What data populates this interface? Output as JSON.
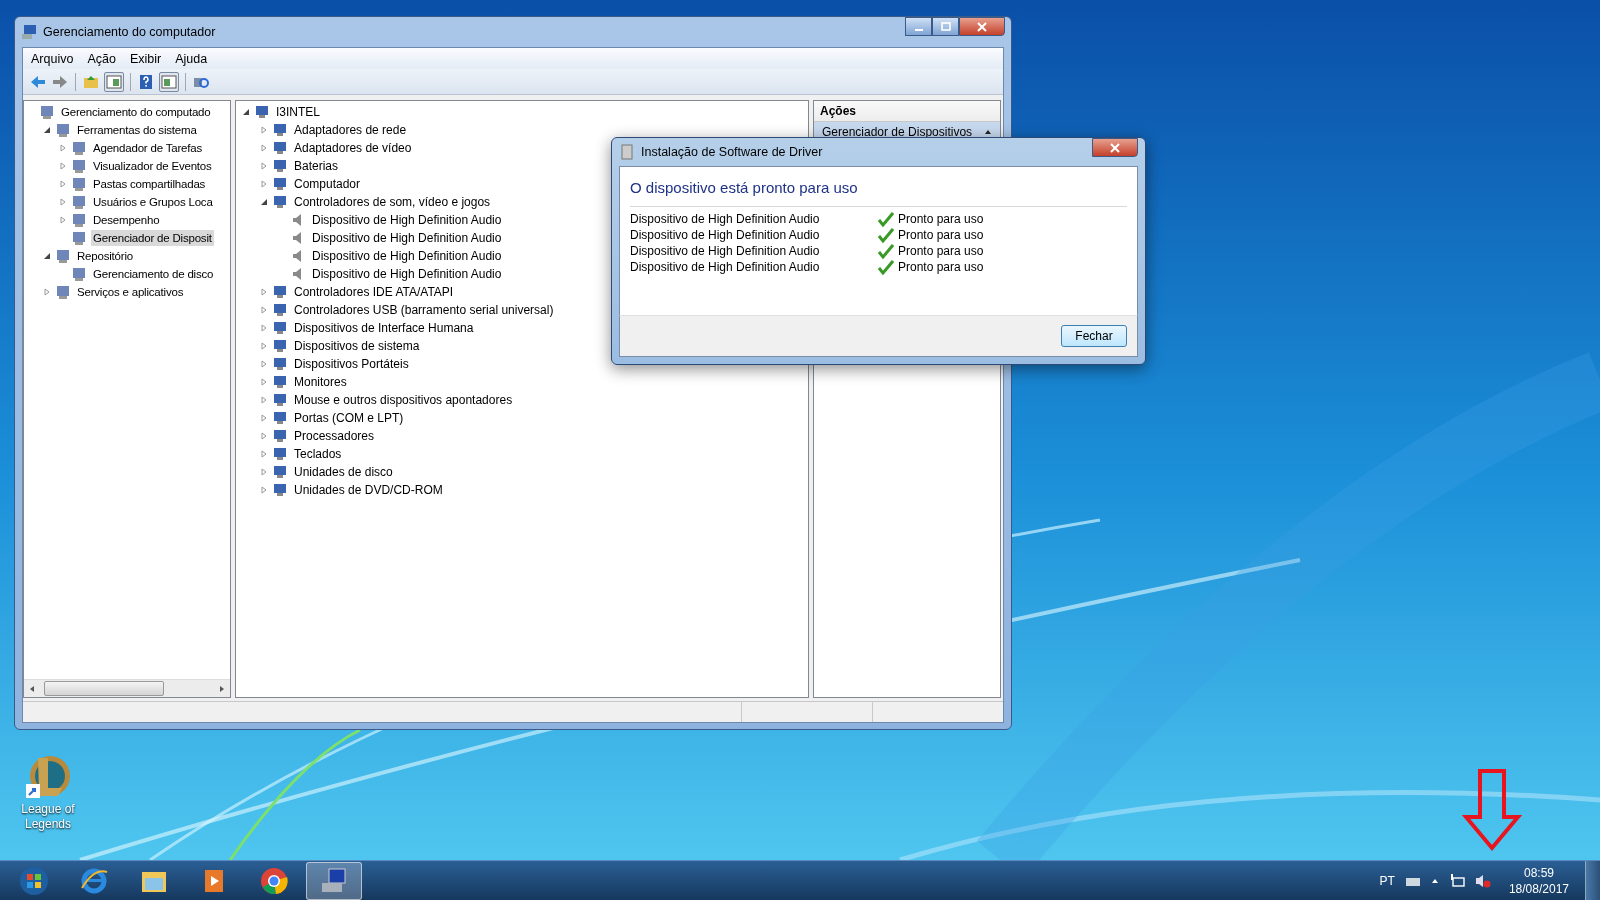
{
  "window": {
    "title": "Gerenciamento do computador",
    "menu": [
      "Arquivo",
      "Ação",
      "Exibir",
      "Ajuda"
    ]
  },
  "nav_tree": [
    {
      "label": "Gerenciamento do computado",
      "kind": "leaf",
      "selected": false,
      "children": [
        {
          "label": "Ferramentas do sistema",
          "kind": "branch",
          "expanded": true,
          "selected": false,
          "children": [
            {
              "label": "Agendador de Tarefas",
              "kind": "branch",
              "expanded": false,
              "selected": false
            },
            {
              "label": "Visualizador de Eventos",
              "kind": "branch",
              "expanded": false,
              "selected": false
            },
            {
              "label": "Pastas compartilhadas",
              "kind": "branch",
              "expanded": false,
              "selected": false
            },
            {
              "label": "Usuários e Grupos Loca",
              "kind": "branch",
              "expanded": false,
              "selected": false
            },
            {
              "label": "Desempenho",
              "kind": "branch",
              "expanded": false,
              "selected": false
            },
            {
              "label": "Gerenciador de Disposit",
              "kind": "leaf",
              "selected": true
            }
          ]
        },
        {
          "label": "Repositório",
          "kind": "branch",
          "expanded": true,
          "selected": false,
          "children": [
            {
              "label": "Gerenciamento de disco",
              "kind": "leaf",
              "selected": false
            }
          ]
        },
        {
          "label": "Serviços e aplicativos",
          "kind": "branch",
          "expanded": false,
          "selected": false
        }
      ]
    }
  ],
  "device_tree": [
    {
      "label": "I3INTEL",
      "kind": "branch",
      "expanded": true,
      "children": [
        {
          "label": "Adaptadores de rede",
          "kind": "branch",
          "expanded": false
        },
        {
          "label": "Adaptadores de vídeo",
          "kind": "branch",
          "expanded": false
        },
        {
          "label": "Baterias",
          "kind": "branch",
          "expanded": false
        },
        {
          "label": "Computador",
          "kind": "branch",
          "expanded": false
        },
        {
          "label": "Controladores de som, vídeo e jogos",
          "kind": "branch",
          "expanded": true,
          "children": [
            {
              "label": "Dispositivo de High Definition Audio",
              "kind": "leaf"
            },
            {
              "label": "Dispositivo de High Definition Audio",
              "kind": "leaf"
            },
            {
              "label": "Dispositivo de High Definition Audio",
              "kind": "leaf"
            },
            {
              "label": "Dispositivo de High Definition Audio",
              "kind": "leaf"
            }
          ]
        },
        {
          "label": "Controladores IDE ATA/ATAPI",
          "kind": "branch",
          "expanded": false
        },
        {
          "label": "Controladores USB (barramento serial universal)",
          "kind": "branch",
          "expanded": false
        },
        {
          "label": "Dispositivos de Interface Humana",
          "kind": "branch",
          "expanded": false
        },
        {
          "label": "Dispositivos de sistema",
          "kind": "branch",
          "expanded": false
        },
        {
          "label": "Dispositivos Portáteis",
          "kind": "branch",
          "expanded": false
        },
        {
          "label": "Monitores",
          "kind": "branch",
          "expanded": false
        },
        {
          "label": "Mouse e outros dispositivos apontadores",
          "kind": "branch",
          "expanded": false
        },
        {
          "label": "Portas (COM e LPT)",
          "kind": "branch",
          "expanded": false
        },
        {
          "label": "Processadores",
          "kind": "branch",
          "expanded": false
        },
        {
          "label": "Teclados",
          "kind": "branch",
          "expanded": false
        },
        {
          "label": "Unidades de disco",
          "kind": "branch",
          "expanded": false
        },
        {
          "label": "Unidades de DVD/CD-ROM",
          "kind": "branch",
          "expanded": false
        }
      ]
    }
  ],
  "actions": {
    "title": "Ações",
    "section": "Gerenciador de Dispositivos"
  },
  "dialog": {
    "title": "Instalação de Software de Driver",
    "heading": "O dispositivo está pronto para uso",
    "rows": [
      {
        "device": "Dispositivo de High Definition Audio",
        "status": "Pronto para uso"
      },
      {
        "device": "Dispositivo de High Definition Audio",
        "status": "Pronto para uso"
      },
      {
        "device": "Dispositivo de High Definition Audio",
        "status": "Pronto para uso"
      },
      {
        "device": "Dispositivo de High Definition Audio",
        "status": "Pronto para uso"
      }
    ],
    "button": "Fechar"
  },
  "desktop_icons": [
    {
      "label": "League of Legends"
    }
  ],
  "taskbar": {
    "apps": [
      {
        "selected": false
      },
      {
        "selected": false
      },
      {
        "selected": false
      },
      {
        "selected": false
      },
      {
        "selected": false
      },
      {
        "selected": true
      }
    ],
    "language": "PT",
    "time": "08:59",
    "date": "18/08/2017"
  }
}
